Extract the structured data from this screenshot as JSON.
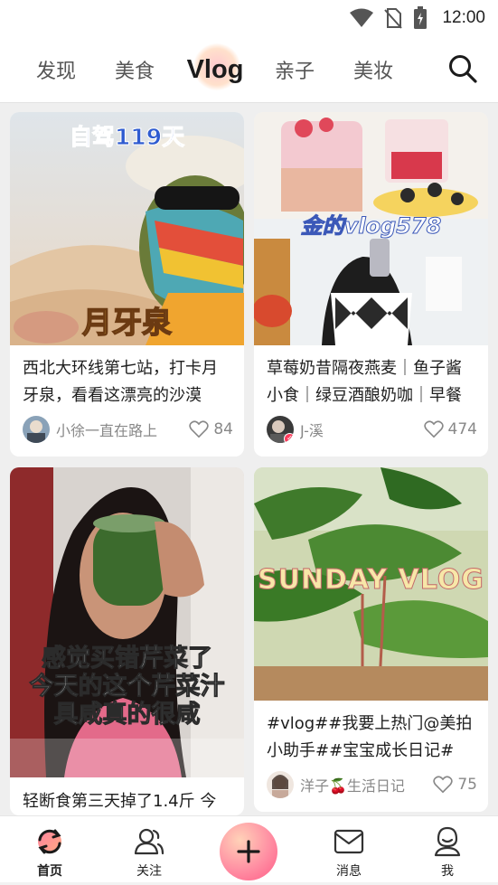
{
  "status_bar": {
    "time": "12:00"
  },
  "top_nav": {
    "tabs": [
      "发现",
      "美食",
      "Vlog",
      "亲子",
      "美妆"
    ],
    "active_tab": "Vlog"
  },
  "feed": [
    {
      "overlay_top": "自驾119天",
      "overlay_bottom": "月牙泉",
      "title": "西北大环线第七站，打卡月牙泉，看看这漂亮的沙漠",
      "author": "小徐一直在路上",
      "likes": "84"
    },
    {
      "overlay_top": "金的vlog578",
      "title": "草莓奶昔隔夜燕麦｜鱼子酱小食｜绿豆酒酿奶咖｜早餐",
      "author": "J-溪",
      "likes": "474"
    },
    {
      "overlay_lines": [
        "感觉买错芹菜了",
        "今天的这个芹菜汁",
        "具咸真的很咸"
      ],
      "title": "轻断食第三天掉了1.4斤 今",
      "author": "",
      "likes": ""
    },
    {
      "overlay_top": "SUNDAY VLOG",
      "title": "#vlog##我要上热门@美拍小助手##宝宝成长日记#",
      "author": "洋子🍒生活日记",
      "likes": "75"
    }
  ],
  "bottom_nav": {
    "home": "首页",
    "follow": "关注",
    "messages": "消息",
    "me": "我"
  },
  "colors": {
    "accent_pink": "#ff5a86",
    "like_gray": "#888888",
    "active_tab_glow": "#ffc8cf"
  },
  "icons": [
    "wifi-icon",
    "no-sim-icon",
    "battery-icon",
    "search-icon",
    "heart-icon",
    "home-refresh-icon",
    "follow-icon",
    "plus-icon",
    "message-icon",
    "me-icon"
  ]
}
